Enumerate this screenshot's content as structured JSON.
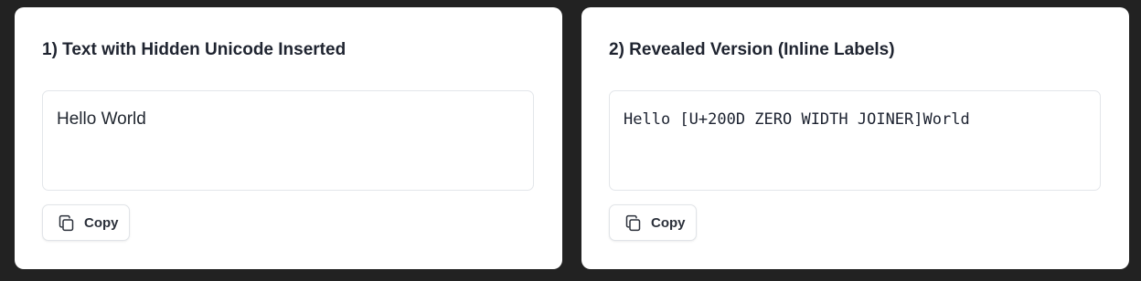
{
  "panels": [
    {
      "title": "1) Text with Hidden Unicode Inserted",
      "text": "Hello World",
      "copy_label": "Copy"
    },
    {
      "title": "2) Revealed Version (Inline Labels)",
      "text": "Hello [U+200D ZERO WIDTH JOINER]World",
      "copy_label": "Copy"
    }
  ],
  "icons": {
    "copy": "copy-icon"
  },
  "colors": {
    "page_background": "#222222",
    "panel_background": "#ffffff",
    "border": "#e3e6ea",
    "text": "#1f2430"
  }
}
